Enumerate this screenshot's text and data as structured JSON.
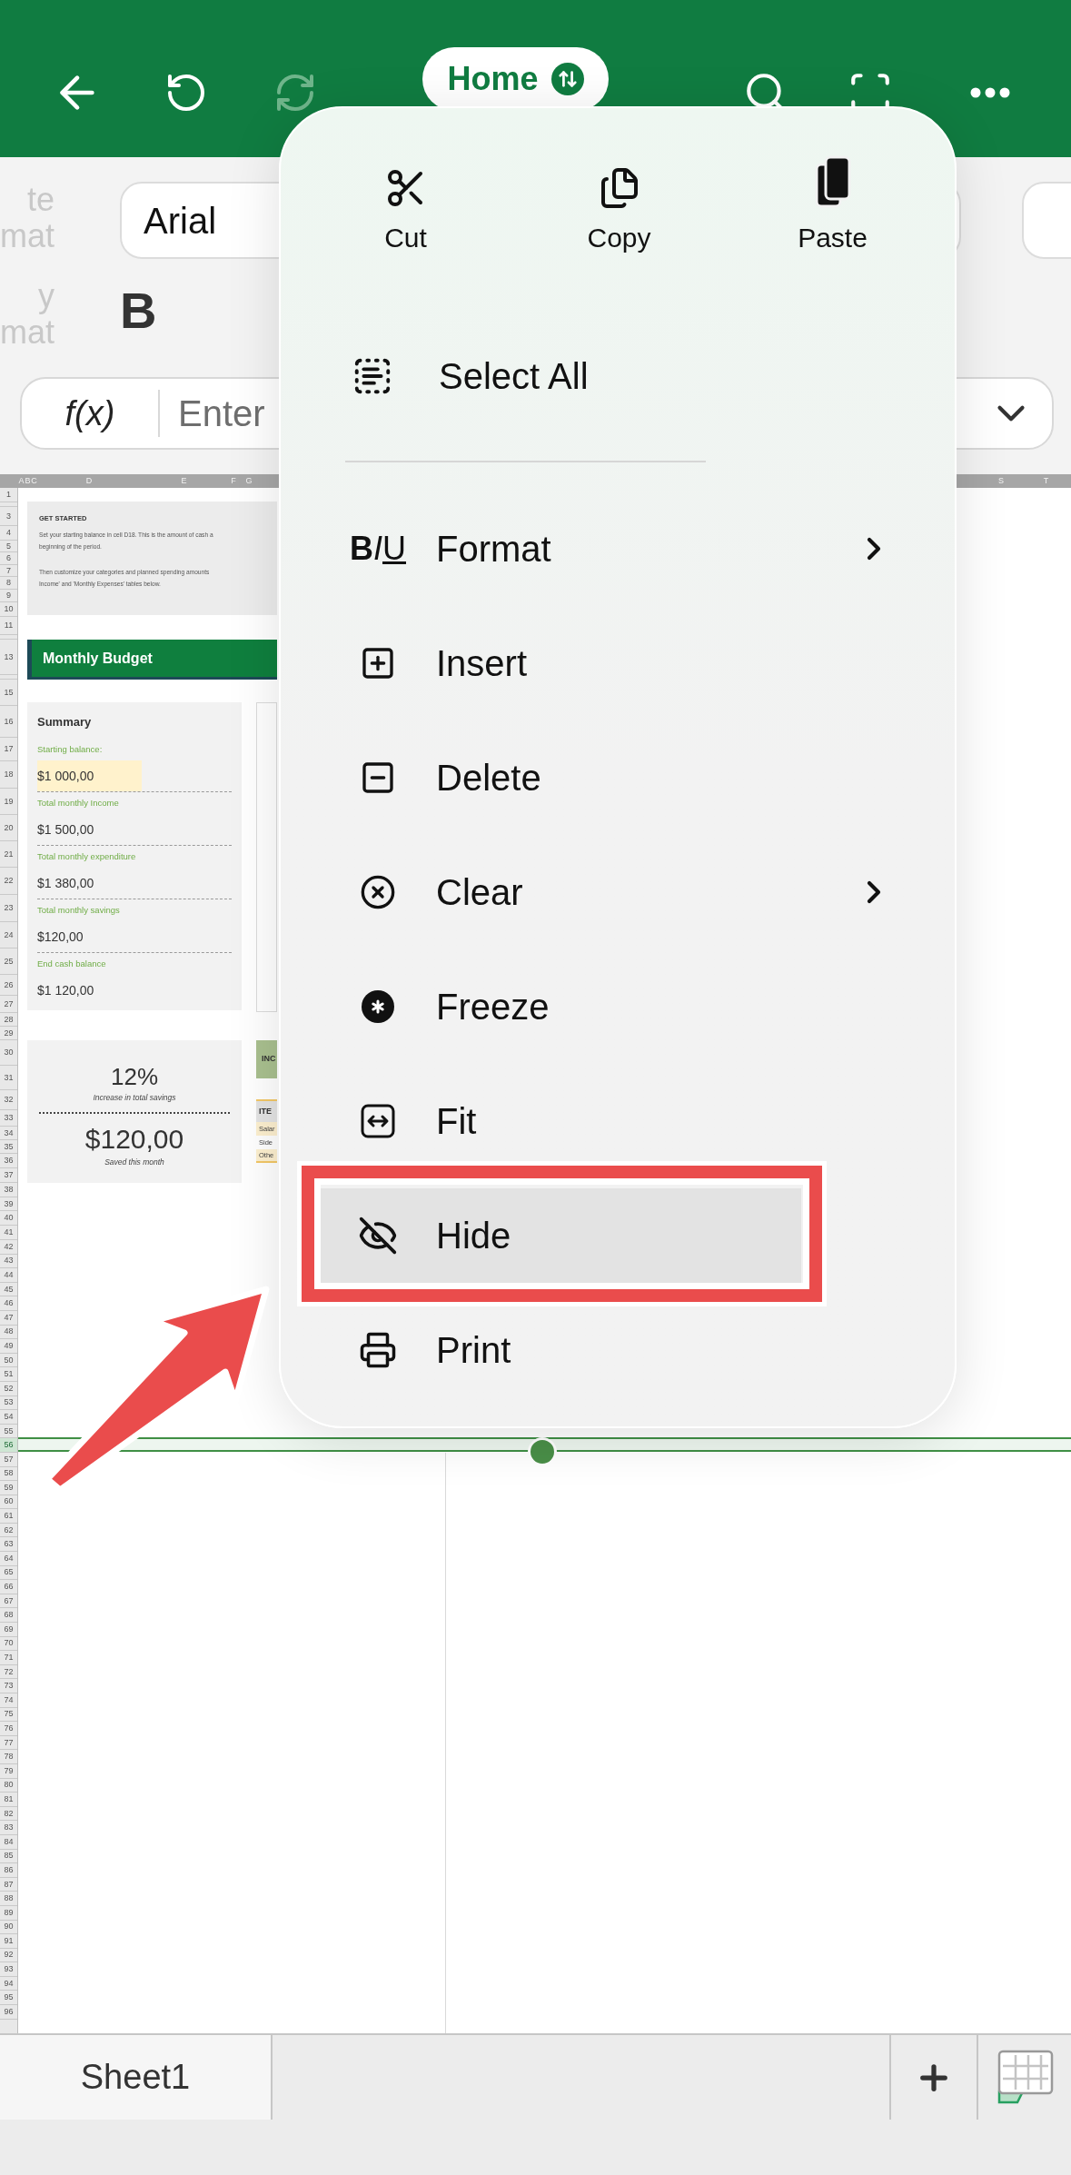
{
  "toolbar": {
    "tab_label": "Home"
  },
  "ribbon": {
    "clipped_labels": [
      "te",
      "mat",
      "y",
      "mat"
    ],
    "font_name": "Arial",
    "bold_button": "B"
  },
  "formula_bar": {
    "function_button": "f(x)",
    "placeholder": "Enter"
  },
  "column_headers": [
    {
      "label": "A"
    },
    {
      "label": "B"
    },
    {
      "label": "C"
    },
    {
      "label": "D"
    },
    {
      "label": "E"
    },
    {
      "label": "F"
    },
    {
      "label": "G"
    },
    {
      "label": "S"
    },
    {
      "label": "T"
    }
  ],
  "row_headers": [
    {
      "label": "1",
      "selected": false
    },
    {
      "selected": false
    },
    {
      "label": "3",
      "selected": false
    },
    {
      "label": "4",
      "selected": false
    },
    {
      "label": "5",
      "selected": false
    },
    {
      "label": "6",
      "selected": false
    },
    {
      "label": "7",
      "selected": false
    },
    {
      "label": "8",
      "selected": false
    },
    {
      "label": "9",
      "selected": false
    },
    {
      "label": "10",
      "selected": false
    },
    {
      "label": "11",
      "selected": false
    },
    {
      "selected": false
    },
    {
      "label": "13",
      "selected": false
    },
    {
      "selected": false
    },
    {
      "label": "15",
      "selected": false
    },
    {
      "label": "16",
      "selected": false
    },
    {
      "label": "17",
      "selected": false
    },
    {
      "label": "18",
      "selected": false
    },
    {
      "label": "19",
      "selected": false
    },
    {
      "label": "20",
      "selected": false
    },
    {
      "label": "21",
      "selected": false
    },
    {
      "label": "22",
      "selected": false
    },
    {
      "label": "23",
      "selected": false
    },
    {
      "label": "24",
      "selected": false
    },
    {
      "label": "25",
      "selected": false
    },
    {
      "label": "26",
      "selected": false
    },
    {
      "label": "27",
      "selected": false
    },
    {
      "label": "28",
      "selected": false
    },
    {
      "label": "29",
      "selected": false
    },
    {
      "label": "30",
      "selected": false
    },
    {
      "label": "31",
      "selected": false
    },
    {
      "label": "32",
      "selected": false
    },
    {
      "label": "33",
      "selected": false
    },
    {
      "label": "34",
      "selected": false
    },
    {
      "label": "35",
      "selected": false
    },
    {
      "label": "36",
      "selected": false
    },
    {
      "label": "37",
      "selected": false
    },
    {
      "label": "38",
      "selected": false
    },
    {
      "label": "39",
      "selected": false
    },
    {
      "label": "40",
      "selected": false
    },
    {
      "label": "41",
      "selected": false
    },
    {
      "label": "42",
      "selected": false
    },
    {
      "label": "43",
      "selected": false
    },
    {
      "label": "44",
      "selected": false
    },
    {
      "label": "45",
      "selected": false
    },
    {
      "label": "46",
      "selected": false
    },
    {
      "label": "47",
      "selected": false
    },
    {
      "label": "48",
      "selected": false
    },
    {
      "label": "49",
      "selected": false
    },
    {
      "label": "50",
      "selected": false
    },
    {
      "label": "51",
      "selected": false
    },
    {
      "label": "52",
      "selected": false
    },
    {
      "label": "53",
      "selected": false
    },
    {
      "label": "54",
      "selected": false
    },
    {
      "label": "55",
      "selected": false
    },
    {
      "label": "56",
      "selected": true
    },
    {
      "label": "57",
      "selected": false
    },
    {
      "label": "58",
      "selected": false
    },
    {
      "label": "59",
      "selected": false
    },
    {
      "label": "60",
      "selected": false
    },
    {
      "label": "61",
      "selected": false
    },
    {
      "label": "62",
      "selected": false
    },
    {
      "label": "63",
      "selected": false
    },
    {
      "label": "64",
      "selected": false
    },
    {
      "label": "65",
      "selected": false
    },
    {
      "label": "66",
      "selected": false
    },
    {
      "label": "67",
      "selected": false
    },
    {
      "label": "68",
      "selected": false
    },
    {
      "label": "69",
      "selected": false
    },
    {
      "label": "70",
      "selected": false
    },
    {
      "label": "71",
      "selected": false
    },
    {
      "label": "72",
      "selected": false
    },
    {
      "label": "73",
      "selected": false
    },
    {
      "label": "74",
      "selected": false
    },
    {
      "label": "75",
      "selected": false
    },
    {
      "label": "76",
      "selected": false
    },
    {
      "label": "77",
      "selected": false
    },
    {
      "label": "78",
      "selected": false
    },
    {
      "label": "79",
      "selected": false
    },
    {
      "label": "80",
      "selected": false
    },
    {
      "label": "81",
      "selected": false
    },
    {
      "label": "82",
      "selected": false
    },
    {
      "label": "83",
      "selected": false
    },
    {
      "label": "84",
      "selected": false
    },
    {
      "label": "85",
      "selected": false
    },
    {
      "label": "86",
      "selected": false
    },
    {
      "label": "87",
      "selected": false
    },
    {
      "label": "88",
      "selected": false
    },
    {
      "label": "89",
      "selected": false
    },
    {
      "label": "90",
      "selected": false
    },
    {
      "label": "91",
      "selected": false
    },
    {
      "label": "92",
      "selected": false
    },
    {
      "label": "93",
      "selected": false
    },
    {
      "label": "94",
      "selected": false
    },
    {
      "label": "95",
      "selected": false
    },
    {
      "label": "96",
      "selected": false
    }
  ],
  "sheet": {
    "get_started": {
      "title": "GET STARTED",
      "paragraphs": [
        [
          "Set your starting balance in cell D18. This is the amount of cash a",
          "beginning of the period."
        ],
        [
          "Then customize your categories and planned spending amounts",
          "Income' and 'Monthly Expenses' tables below."
        ]
      ]
    },
    "banner": "Monthly Budget",
    "summary": {
      "title": "Summary",
      "entries": [
        {
          "label": "Starting balance:",
          "value": "$1 000,00",
          "highlighted": true
        },
        {
          "label": "Total monthly Income",
          "value": "$1 500,00",
          "highlighted": false
        },
        {
          "label": "Total monthly expenditure",
          "value": "$1 380,00",
          "highlighted": false
        },
        {
          "label": "Total monthly savings",
          "value": "$120,00",
          "highlighted": false
        },
        {
          "label": "End cash balance",
          "value": "$1 120,00",
          "highlighted": false
        }
      ]
    },
    "stats": [
      {
        "value": "12%",
        "caption": "Increase in total savings"
      },
      {
        "value": "$120,00",
        "caption": "Saved this month"
      }
    ],
    "income_table": {
      "header": "INC",
      "column_header": "ITE",
      "rows": [
        "Salar",
        "Side",
        "Othe"
      ]
    }
  },
  "context_menu": {
    "clipboard_actions": [
      {
        "label": "Cut"
      },
      {
        "label": "Copy"
      },
      {
        "label": "Paste"
      }
    ],
    "primary_items": [
      {
        "label": "Select All",
        "selected": false
      }
    ],
    "items": [
      {
        "label": "Format",
        "icon_letters": [
          "B",
          "I",
          "U"
        ],
        "submenu": true,
        "selected": false
      },
      {
        "label": "Insert",
        "submenu": false,
        "selected": false
      },
      {
        "label": "Delete",
        "submenu": false,
        "selected": false
      },
      {
        "label": "Clear",
        "submenu": true,
        "selected": false
      },
      {
        "label": "Freeze",
        "submenu": false,
        "selected": false
      },
      {
        "label": "Fit",
        "submenu": false,
        "selected": false
      },
      {
        "label": "Hide",
        "submenu": false,
        "selected": true
      },
      {
        "label": "Print",
        "submenu": false,
        "selected": false
      }
    ]
  },
  "sheet_tabs": [
    {
      "label": "Sheet1",
      "selected": true
    }
  ]
}
